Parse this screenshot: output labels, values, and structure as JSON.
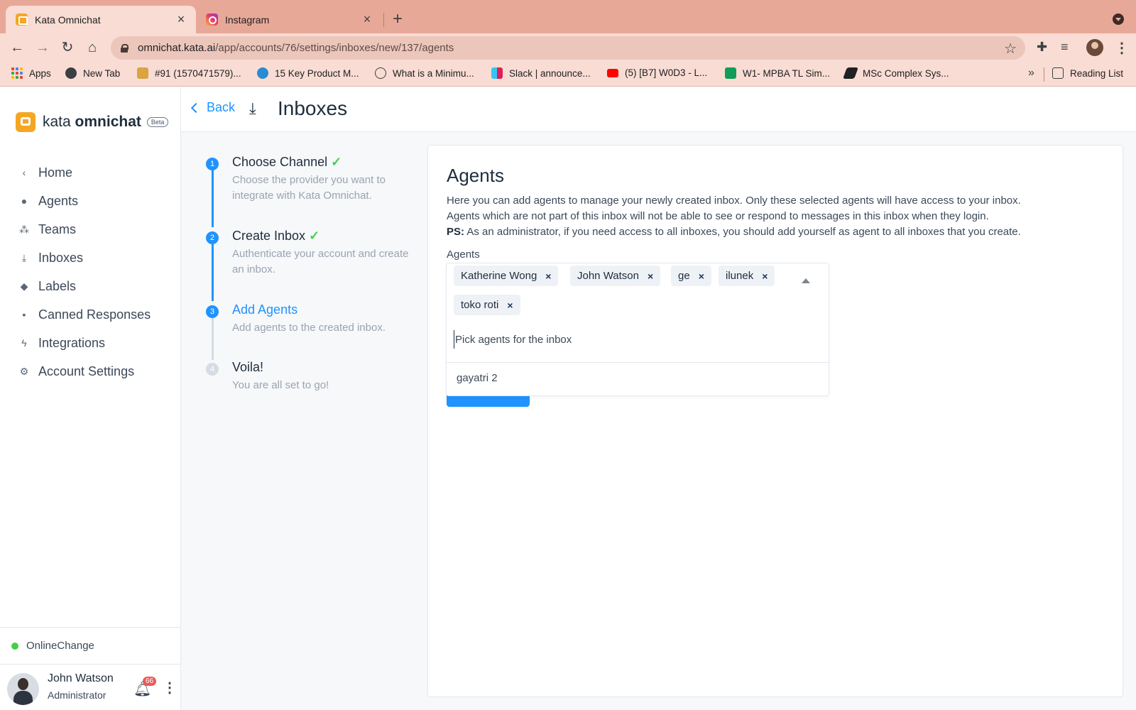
{
  "browser": {
    "tabs": [
      {
        "title": "Kata Omnichat",
        "icon": "kata-favicon"
      },
      {
        "title": "Instagram",
        "icon": "instagram-favicon"
      }
    ],
    "url_host": "omnichat.kata.ai",
    "url_path": "/app/accounts/76/settings/inboxes/new/137/agents",
    "bookmarks": [
      {
        "label": "Apps"
      },
      {
        "label": "New Tab"
      },
      {
        "label": "#91 (1570471579)..."
      },
      {
        "label": "15 Key Product M..."
      },
      {
        "label": "What is a Minimu..."
      },
      {
        "label": "Slack | announce..."
      },
      {
        "label": "(5) [B7] W0D3 - L..."
      },
      {
        "label": "W1- MPBA TL Sim..."
      },
      {
        "label": "MSc Complex Sys..."
      }
    ],
    "more_bookmarks": "»",
    "reading_list": "Reading List"
  },
  "sidebar": {
    "brand_light": "kata ",
    "brand_bold": "omnichat",
    "beta": "Beta",
    "items": [
      {
        "label": "Home",
        "icon": "chevron-left-icon"
      },
      {
        "label": "Agents",
        "icon": "people-icon"
      },
      {
        "label": "Teams",
        "icon": "team-icon"
      },
      {
        "label": "Inboxes",
        "icon": "inbox-icon"
      },
      {
        "label": "Labels",
        "icon": "tag-icon"
      },
      {
        "label": "Canned Responses",
        "icon": "chat-icon"
      },
      {
        "label": "Integrations",
        "icon": "bolt-icon"
      },
      {
        "label": "Account Settings",
        "icon": "gear-icon"
      }
    ],
    "status": "Online",
    "change": "Change",
    "user_name": "John Watson",
    "user_role": "Administrator",
    "notifications": "66"
  },
  "header": {
    "back": "Back",
    "title": "Inboxes"
  },
  "steps": [
    {
      "num": "1",
      "title": "Choose Channel",
      "desc": "Choose the provider you want to integrate with Kata Omnichat.",
      "done": true
    },
    {
      "num": "2",
      "title": "Create Inbox",
      "desc": "Authenticate your account and create an inbox.",
      "done": true
    },
    {
      "num": "3",
      "title": "Add Agents",
      "desc": "Add agents to the created inbox.",
      "done": false
    },
    {
      "num": "4",
      "title": "Voila!",
      "desc": "You are all set to go!",
      "done": false
    }
  ],
  "card": {
    "title": "Agents",
    "desc_line1": "Here you can add agents to manage your newly created inbox. Only these selected agents will have access to your inbox.",
    "desc_line2": "Agents which are not part of this inbox will not be able to see or respond to messages in this inbox when they login.",
    "ps_label": "PS:",
    "ps_text": " As an administrator, if you need access to all inboxes, you should add yourself as agent to all inboxes that you create.",
    "field_label": "Agents",
    "selected_agents": [
      "Katherine Wong",
      "John Watson",
      "ge",
      "ilunek",
      "toko roti"
    ],
    "placeholder": "Pick agents for the inbox",
    "options": [
      "gayatri 2"
    ]
  },
  "colors": {
    "accent": "#1f93ff",
    "online": "#44ce4b",
    "brand": "#f5a623",
    "chrome_tab": "#e8a898"
  }
}
